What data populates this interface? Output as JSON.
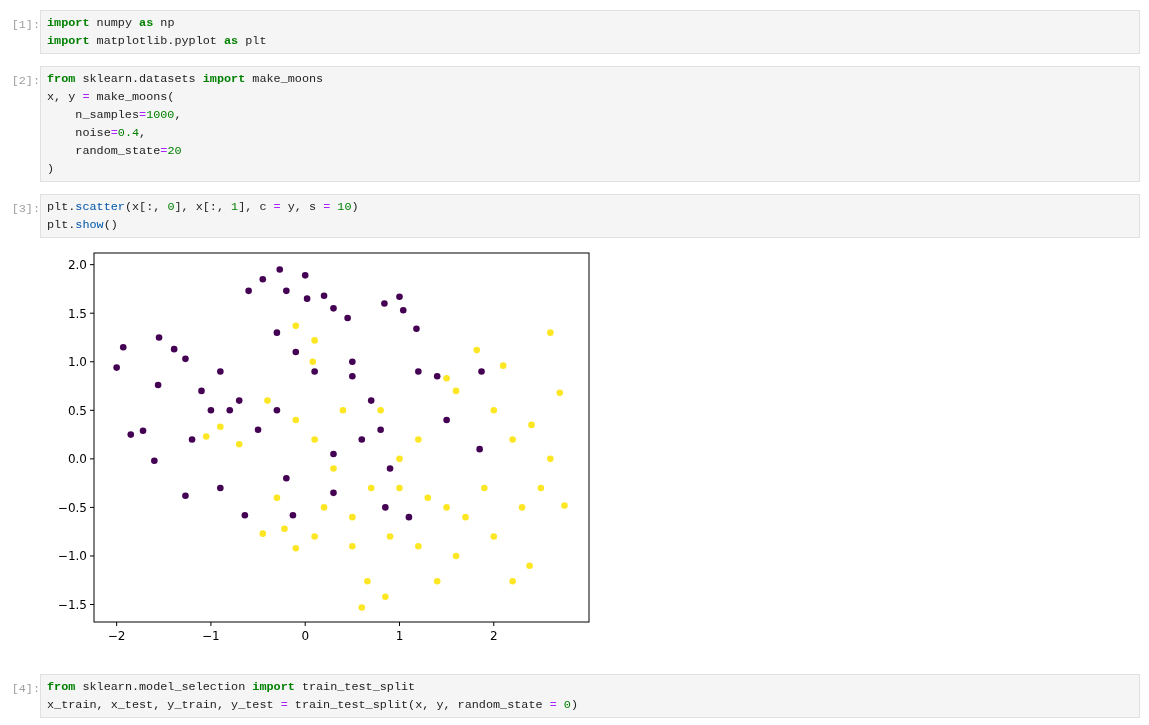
{
  "cells": [
    {
      "prompt": "[1]:",
      "lines": [
        [
          {
            "t": "import",
            "kind": "kw"
          },
          {
            "t": " numpy ",
            "kind": "plain"
          },
          {
            "t": "as",
            "kind": "kw"
          },
          {
            "t": " np",
            "kind": "plain"
          }
        ],
        [
          {
            "t": "import",
            "kind": "kw"
          },
          {
            "t": " matplotlib.pyplot ",
            "kind": "plain"
          },
          {
            "t": "as",
            "kind": "kw"
          },
          {
            "t": " plt",
            "kind": "plain"
          }
        ]
      ]
    },
    {
      "prompt": "[2]:",
      "lines": [
        [
          {
            "t": "from",
            "kind": "kw"
          },
          {
            "t": " sklearn.datasets ",
            "kind": "plain"
          },
          {
            "t": "import",
            "kind": "kw"
          },
          {
            "t": " make_moons",
            "kind": "plain"
          }
        ],
        [
          {
            "t": "x, y ",
            "kind": "plain"
          },
          {
            "t": "=",
            "kind": "op"
          },
          {
            "t": " make_moons(",
            "kind": "plain"
          }
        ],
        [
          {
            "t": "    n_samples",
            "kind": "plain"
          },
          {
            "t": "=",
            "kind": "op"
          },
          {
            "t": "1000",
            "kind": "num"
          },
          {
            "t": ",",
            "kind": "plain"
          }
        ],
        [
          {
            "t": "    noise",
            "kind": "plain"
          },
          {
            "t": "=",
            "kind": "op"
          },
          {
            "t": "0.4",
            "kind": "num"
          },
          {
            "t": ",",
            "kind": "plain"
          }
        ],
        [
          {
            "t": "    random_state",
            "kind": "plain"
          },
          {
            "t": "=",
            "kind": "op"
          },
          {
            "t": "20",
            "kind": "num"
          }
        ],
        [
          {
            "t": ")",
            "kind": "plain"
          }
        ]
      ]
    },
    {
      "prompt": "[3]:",
      "lines": [
        [
          {
            "t": "plt.",
            "kind": "plain"
          },
          {
            "t": "scatter",
            "kind": "fn"
          },
          {
            "t": "(x[:, ",
            "kind": "plain"
          },
          {
            "t": "0",
            "kind": "num"
          },
          {
            "t": "], x[:, ",
            "kind": "plain"
          },
          {
            "t": "1",
            "kind": "num"
          },
          {
            "t": "], c ",
            "kind": "plain"
          },
          {
            "t": "=",
            "kind": "op"
          },
          {
            "t": " y, s ",
            "kind": "plain"
          },
          {
            "t": "=",
            "kind": "op"
          },
          {
            "t": " 10",
            "kind": "num"
          },
          {
            "t": ")",
            "kind": "plain"
          }
        ],
        [
          {
            "t": "plt.",
            "kind": "plain"
          },
          {
            "t": "show",
            "kind": "fn"
          },
          {
            "t": "()",
            "kind": "plain"
          }
        ]
      ],
      "output": {
        "chart_data": {
          "type": "scatter",
          "xlim": [
            -2.24,
            3.01
          ],
          "ylim": [
            -1.68,
            2.12
          ],
          "xticks": [
            {
              "value": -2,
              "label": "−2"
            },
            {
              "value": -1,
              "label": "−1"
            },
            {
              "value": 0,
              "label": "0"
            },
            {
              "value": 1,
              "label": "1"
            },
            {
              "value": 2,
              "label": "2"
            }
          ],
          "yticks": [
            {
              "value": 2,
              "label": "2.0"
            },
            {
              "value": 1.5,
              "label": "1.5"
            },
            {
              "value": 1,
              "label": "1.0"
            },
            {
              "value": 0.5,
              "label": "0.5"
            },
            {
              "value": 0,
              "label": "0.0"
            },
            {
              "value": -0.5,
              "label": "−0.5"
            },
            {
              "value": -1,
              "label": "−1.0"
            },
            {
              "value": -1.5,
              "label": "−1.5"
            }
          ],
          "series": [
            {
              "color": "#440154",
              "x": [
                -2.0,
                -1.93,
                -1.85,
                -1.72,
                -1.6,
                -1.56,
                -1.55,
                -1.39,
                -1.27,
                -1.27,
                -1.1,
                -1.0,
                -0.9,
                -0.8,
                -0.7,
                -0.64,
                -0.6,
                -0.5,
                -0.45,
                -0.27,
                -0.2,
                0,
                0.02,
                0.2,
                0.3,
                -0.3,
                -0.1,
                0.1,
                0.5,
                0.5,
                0.45,
                0.84,
                1.0,
                1.04,
                1.18,
                1.4,
                1.5,
                1.87,
                1.85,
                0.8,
                0.9,
                0.85,
                1.1,
                -0.13,
                -0.2,
                0.3,
                -0.3,
                0.7,
                -1.2,
                -0.9,
                0.3,
                1.2,
                0.6
              ],
              "values": [
                0.94,
                1.15,
                0.25,
                0.29,
                -0.02,
                0.76,
                1.25,
                1.13,
                -0.38,
                1.03,
                0.7,
                0.5,
                -0.3,
                0.5,
                0.6,
                -0.58,
                1.73,
                0.3,
                1.85,
                1.95,
                1.73,
                1.89,
                1.65,
                1.68,
                1.55,
                1.3,
                1.1,
                0.9,
                0.85,
                1.0,
                1.45,
                1.6,
                1.67,
                1.53,
                1.34,
                0.85,
                0.4,
                0.9,
                0.1,
                0.3,
                -0.1,
                -0.5,
                -0.6,
                -0.58,
                -0.2,
                -0.35,
                0.5,
                0.6,
                0.2,
                0.9,
                0.05,
                0.9,
                0.2
              ]
            },
            {
              "color": "#fde725",
              "x": [
                2.6,
                1.82,
                2.1,
                2.7,
                2.75,
                2.38,
                2.2,
                1.4,
                0.85,
                0.6,
                0.66,
                -0.45,
                -0.1,
                -0.22,
                0.1,
                0.5,
                0.9,
                1.2,
                1.6,
                2.0,
                2.5,
                2.6,
                2.4,
                2.0,
                1.6,
                1.5,
                1.2,
                1.0,
                0.7,
                0.3,
                0.1,
                -0.1,
                -0.4,
                -0.1,
                0.1,
                0.08,
                -0.9,
                -1.05,
                -0.7,
                0.4,
                0.8,
                1.3,
                1.7,
                2.2,
                1.9,
                0.2,
                -0.3,
                1.0,
                1.5,
                0.5,
                2.3
              ],
              "values": [
                1.3,
                1.12,
                0.96,
                0.68,
                -0.48,
                -1.1,
                -1.26,
                -1.26,
                -1.42,
                -1.53,
                -1.26,
                -0.77,
                -0.92,
                -0.72,
                -0.8,
                -0.6,
                -0.8,
                -0.9,
                -1.0,
                -0.8,
                -0.3,
                0.0,
                0.35,
                0.5,
                0.7,
                0.83,
                0.2,
                0.0,
                -0.3,
                -0.1,
                0.2,
                0.4,
                0.6,
                1.37,
                1.22,
                1.0,
                0.33,
                0.23,
                0.15,
                0.5,
                0.5,
                -0.4,
                -0.6,
                0.2,
                -0.3,
                -0.5,
                -0.4,
                -0.3,
                -0.5,
                -0.9,
                -0.5
              ]
            }
          ]
        }
      }
    },
    {
      "prompt": "[4]:",
      "lines": [
        [
          {
            "t": "from",
            "kind": "kw"
          },
          {
            "t": " sklearn.model_selection ",
            "kind": "plain"
          },
          {
            "t": "import",
            "kind": "kw"
          },
          {
            "t": " train_test_split",
            "kind": "plain"
          }
        ],
        [
          {
            "t": "x_train, x_test, y_train, y_test ",
            "kind": "plain"
          },
          {
            "t": "=",
            "kind": "op"
          },
          {
            "t": " train_test_split(x, y, random_state ",
            "kind": "plain"
          },
          {
            "t": "=",
            "kind": "op"
          },
          {
            "t": " 0",
            "kind": "num"
          },
          {
            "t": ")",
            "kind": "plain"
          }
        ]
      ]
    }
  ]
}
